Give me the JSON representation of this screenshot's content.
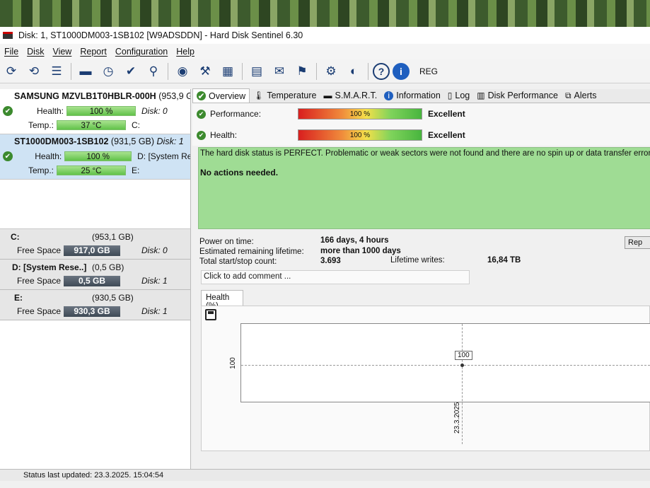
{
  "window": {
    "title": "Disk: 1, ST1000DM003-1SB102 [W9ADSDDN]  -  Hard Disk Sentinel 6.30"
  },
  "menu": [
    "File",
    "Disk",
    "View",
    "Report",
    "Configuration",
    "Help"
  ],
  "toolbar": {
    "reg_label": "REG"
  },
  "disks": [
    {
      "title": "SAMSUNG MZVLB1T0HBLR-000H",
      "size": "(953,9 G",
      "health_label": "Health:",
      "health": "100 %",
      "disk_label": "Disk: 0",
      "temp_label": "Temp.:",
      "temp": "37 °C",
      "drive": "C:"
    },
    {
      "title": "ST1000DM003-1SB102",
      "size": "(931,5 GB)",
      "disk_label": "Disk: 1",
      "health_label": "Health:",
      "health": "100 %",
      "drive1": "D: [System Re",
      "temp_label": "Temp.:",
      "temp": "25 °C",
      "drive2": "E:"
    }
  ],
  "volumes": [
    {
      "name": "C:",
      "size": "(953,1 GB)",
      "free_label": "Free Space",
      "free": "917,0 GB",
      "disk": "Disk: 0"
    },
    {
      "name": "D: [System Rese..]",
      "size": "(0,5 GB)",
      "free_label": "Free Space",
      "free": "0,5 GB",
      "disk": "Disk: 1"
    },
    {
      "name": "E:",
      "size": "(930,5 GB)",
      "free_label": "Free Space",
      "free": "930,3 GB",
      "disk": "Disk: 1"
    }
  ],
  "tabs": [
    "Overview",
    "Temperature",
    "S.M.A.R.T.",
    "Information",
    "Log",
    "Disk Performance",
    "Alerts"
  ],
  "overview": {
    "performance_label": "Performance:",
    "performance": "100 %",
    "performance_rating": "Excellent",
    "health_label": "Health:",
    "health": "100 %",
    "health_rating": "Excellent",
    "status_text": "The hard disk status is PERFECT. Problematic or weak sectors were not found and there are no spin up or data transfer errors.",
    "actions": "No actions needed.",
    "power_on_label": "Power on time:",
    "power_on": "166 days, 4 hours",
    "lifetime_label": "Estimated remaining lifetime:",
    "lifetime": "more than 1000 days",
    "startstop_label": "Total start/stop count:",
    "startstop": "3.693",
    "writes_label": "Lifetime writes:",
    "writes": "16,84 TB",
    "report_button": "Rep",
    "comment_placeholder": "Click to add comment ...",
    "health_tab": "Health (%)"
  },
  "chart_data": {
    "type": "line",
    "title": "",
    "xlabel": "",
    "ylabel": "",
    "x": [
      "23.3.2025"
    ],
    "series": [
      {
        "values": [
          100
        ]
      }
    ],
    "y_ticks": [
      "100"
    ],
    "point_labels": [
      "100"
    ],
    "grid": true
  },
  "statusbar": {
    "text": "Status last updated: 23.3.2025. 15:04:54"
  },
  "colors": {
    "health_bar": "#62c24a",
    "status_bg": "#9fdc94",
    "free_space_bar": "#3f4a56",
    "selected_disk": "#cfe3f4"
  }
}
